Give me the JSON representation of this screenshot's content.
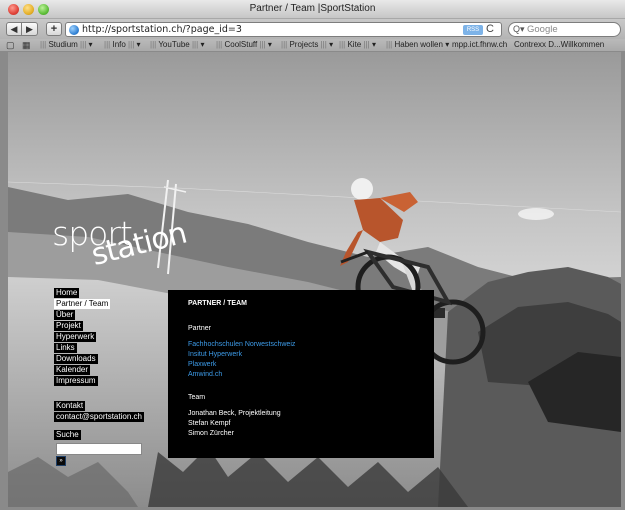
{
  "window": {
    "title": "Partner / Team |SportStation"
  },
  "toolbar": {
    "back_label": "◀",
    "forward_label": "▶",
    "add_label": "+",
    "url": "http://sportstation.ch/?page_id=3",
    "rss_label": "RSS",
    "reload_label": "C",
    "search_placeholder": "Google",
    "search_glyph": "Q▾"
  },
  "bookmarks": {
    "book_icon": "book-icon",
    "grid_icon": "grid-icon",
    "items": [
      {
        "label": "Studium",
        "suffix": "▾"
      },
      {
        "label": "Info",
        "suffix": "▾"
      },
      {
        "label": "YouTube",
        "suffix": "▾"
      },
      {
        "label": "CoolStuff",
        "suffix": "▾"
      },
      {
        "label": "Projects",
        "suffix": "▾"
      },
      {
        "label": "Kite",
        "suffix": "▾"
      },
      {
        "label": "Haben wollen",
        "suffix": "▾"
      },
      {
        "label": "mpp.ict.fhnw.ch",
        "suffix": ""
      },
      {
        "label": "Contrexx D...Willkommen",
        "suffix": ""
      }
    ]
  },
  "site": {
    "logo_word1": "sport",
    "logo_word2": "station",
    "nav": [
      {
        "label": "Home",
        "active": false
      },
      {
        "label": "Partner / Team",
        "active": true
      },
      {
        "label": "Über",
        "active": false
      },
      {
        "label": "Projekt",
        "active": false
      },
      {
        "label": "Hyperwerk",
        "active": false
      },
      {
        "label": "Links",
        "active": false
      },
      {
        "label": "Downloads",
        "active": false
      },
      {
        "label": "Kalender",
        "active": false
      },
      {
        "label": "Impressum",
        "active": false
      }
    ],
    "contact_label": "Kontakt",
    "contact_email": "contact@sportstation.ch",
    "search_label": "Suche",
    "search_submit": "»"
  },
  "content": {
    "title": "PARTNER / TEAM",
    "partner_heading": "Partner",
    "partners": [
      "Fachhochschulen Norwestschweiz",
      "Insitut Hyperwerk",
      "Plaxwerk",
      "Amwind.ch"
    ],
    "team_heading": "Team",
    "team": [
      "Jonathan Beck, Projektleitung",
      "Stefan Kempf",
      "Simon Zürcher"
    ]
  }
}
